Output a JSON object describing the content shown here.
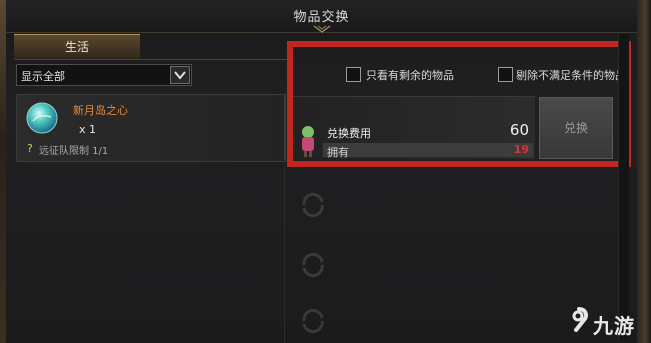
{
  "window": {
    "title": "物品交换"
  },
  "tabs": [
    {
      "label": "生活"
    }
  ],
  "filter": {
    "selected": "显示全部"
  },
  "item": {
    "name": "新月岛之心",
    "quantity": "x 1",
    "limit_icon": "?",
    "limit": "远征队限制 1/1"
  },
  "options": [
    {
      "label": "只看有剩余的物品",
      "checked": false
    },
    {
      "label": "剔除不满足条件的物品",
      "checked": false
    }
  ],
  "cost": {
    "label": "兑换费用",
    "value": "60",
    "own_label": "拥有",
    "own_value": "19",
    "own_value_color": "#e0332f"
  },
  "actions": {
    "exchange_label": "兑换"
  },
  "watermark": {
    "text": "九游"
  },
  "colors": {
    "highlight_box": "#c1261f",
    "item_name": "#e98a3c",
    "tab_gold": "#b59355"
  }
}
